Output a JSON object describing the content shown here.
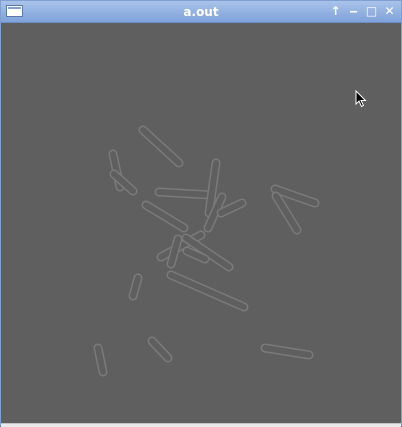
{
  "window": {
    "title": "a.out"
  },
  "icons": {
    "menu": "window-menu-icon",
    "shade": "shade-up-icon",
    "minimize": "minimize-icon",
    "maximize": "maximize-icon",
    "close": "close-icon",
    "cursor": "mouse-pointer-icon"
  },
  "glyphs": {
    "shade": "↑",
    "minimize": "‒",
    "maximize": "□",
    "close": "✕"
  },
  "colors": {
    "titlebar": "#7fa2da",
    "background": "#5f5f5f",
    "rod_outline": "#7a7a7a"
  }
}
